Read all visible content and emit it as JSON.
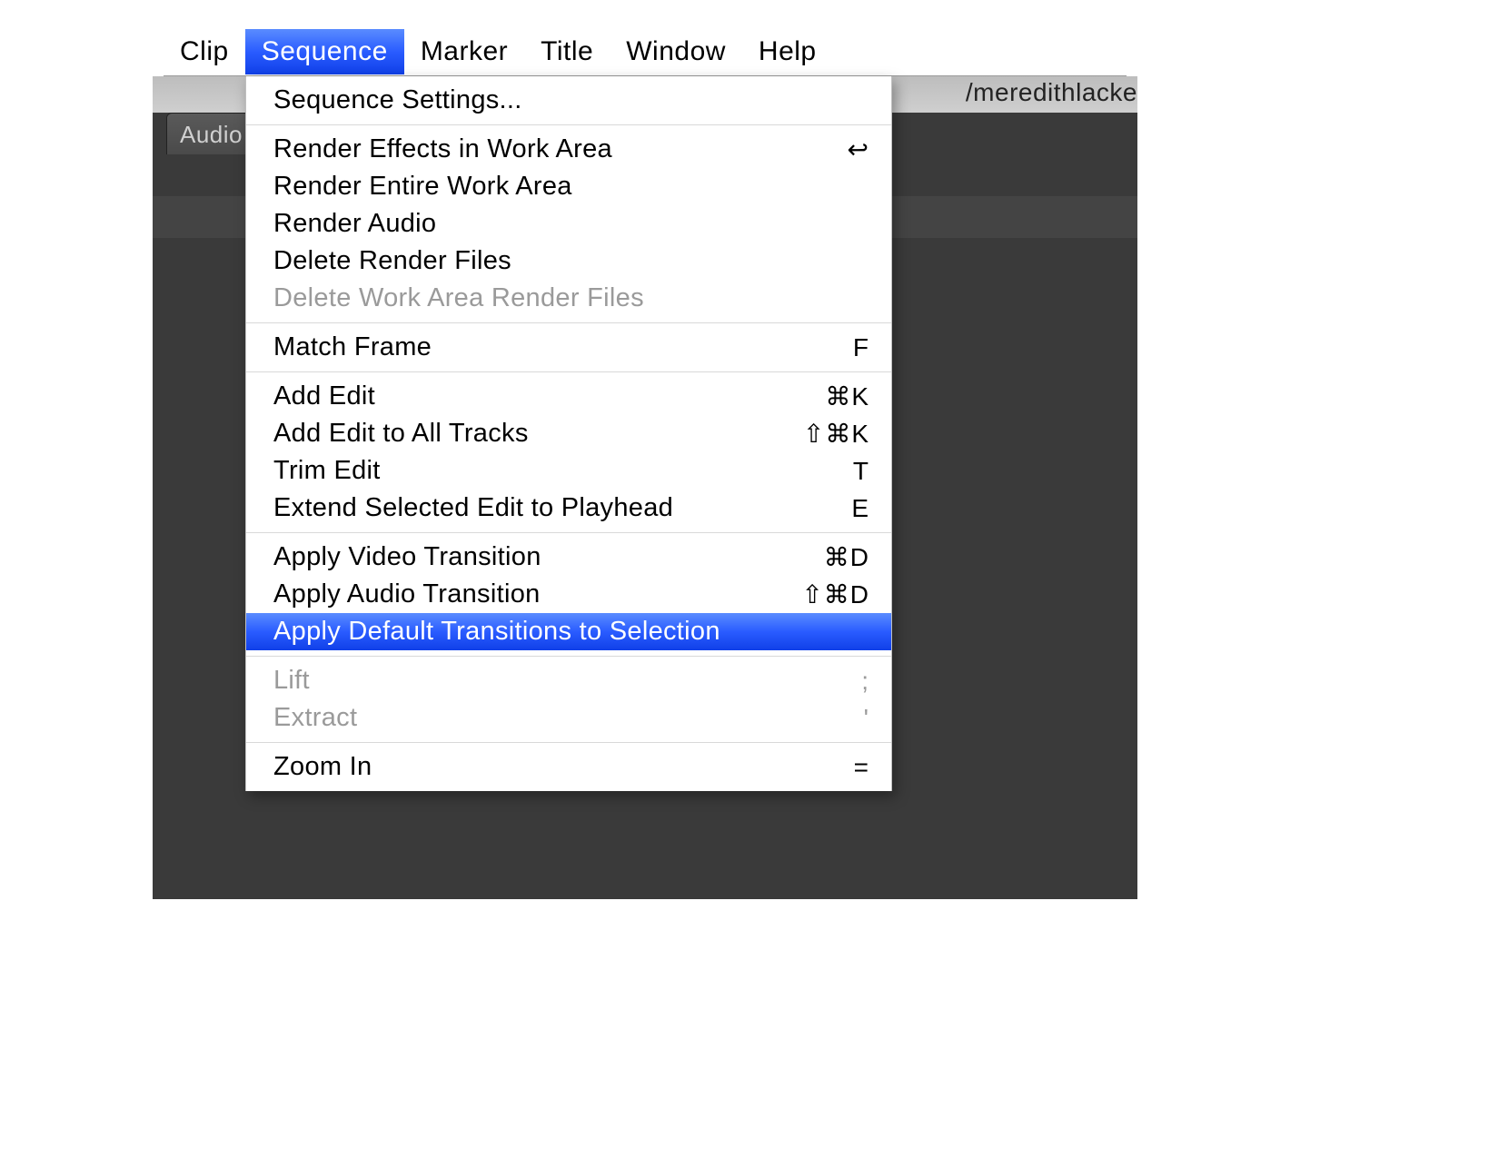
{
  "menubar": {
    "items": [
      {
        "label": "Clip",
        "active": false
      },
      {
        "label": "Sequence",
        "active": true
      },
      {
        "label": "Marker",
        "active": false
      },
      {
        "label": "Title",
        "active": false
      },
      {
        "label": "Window",
        "active": false
      },
      {
        "label": "Help",
        "active": false
      }
    ]
  },
  "pathFragment": "/meredithlacke",
  "sidebarTab": "Audio",
  "dropdown": {
    "groups": [
      {
        "items": [
          {
            "label": "Sequence Settings...",
            "shortcut": "",
            "disabled": false,
            "highlight": false
          }
        ]
      },
      {
        "items": [
          {
            "label": "Render Effects in Work Area",
            "shortcut": "↩",
            "disabled": false,
            "highlight": false
          },
          {
            "label": "Render Entire Work Area",
            "shortcut": "",
            "disabled": false,
            "highlight": false
          },
          {
            "label": "Render Audio",
            "shortcut": "",
            "disabled": false,
            "highlight": false
          },
          {
            "label": "Delete Render Files",
            "shortcut": "",
            "disabled": false,
            "highlight": false
          },
          {
            "label": "Delete Work Area Render Files",
            "shortcut": "",
            "disabled": true,
            "highlight": false
          }
        ]
      },
      {
        "items": [
          {
            "label": "Match Frame",
            "shortcut": "F",
            "disabled": false,
            "highlight": false
          }
        ]
      },
      {
        "items": [
          {
            "label": "Add Edit",
            "shortcut": "⌘K",
            "disabled": false,
            "highlight": false
          },
          {
            "label": "Add Edit to All Tracks",
            "shortcut": "⇧⌘K",
            "disabled": false,
            "highlight": false
          },
          {
            "label": "Trim Edit",
            "shortcut": "T",
            "disabled": false,
            "highlight": false
          },
          {
            "label": "Extend Selected Edit to Playhead",
            "shortcut": "E",
            "disabled": false,
            "highlight": false
          }
        ]
      },
      {
        "items": [
          {
            "label": "Apply Video Transition",
            "shortcut": "⌘D",
            "disabled": false,
            "highlight": false
          },
          {
            "label": "Apply Audio Transition",
            "shortcut": "⇧⌘D",
            "disabled": false,
            "highlight": false
          },
          {
            "label": "Apply Default Transitions to Selection",
            "shortcut": "",
            "disabled": false,
            "highlight": true
          }
        ]
      },
      {
        "items": [
          {
            "label": "Lift",
            "shortcut": ";",
            "disabled": true,
            "highlight": false
          },
          {
            "label": "Extract",
            "shortcut": "'",
            "disabled": true,
            "highlight": false
          }
        ]
      },
      {
        "items": [
          {
            "label": "Zoom In",
            "shortcut": "=",
            "disabled": false,
            "highlight": false
          }
        ]
      }
    ]
  }
}
